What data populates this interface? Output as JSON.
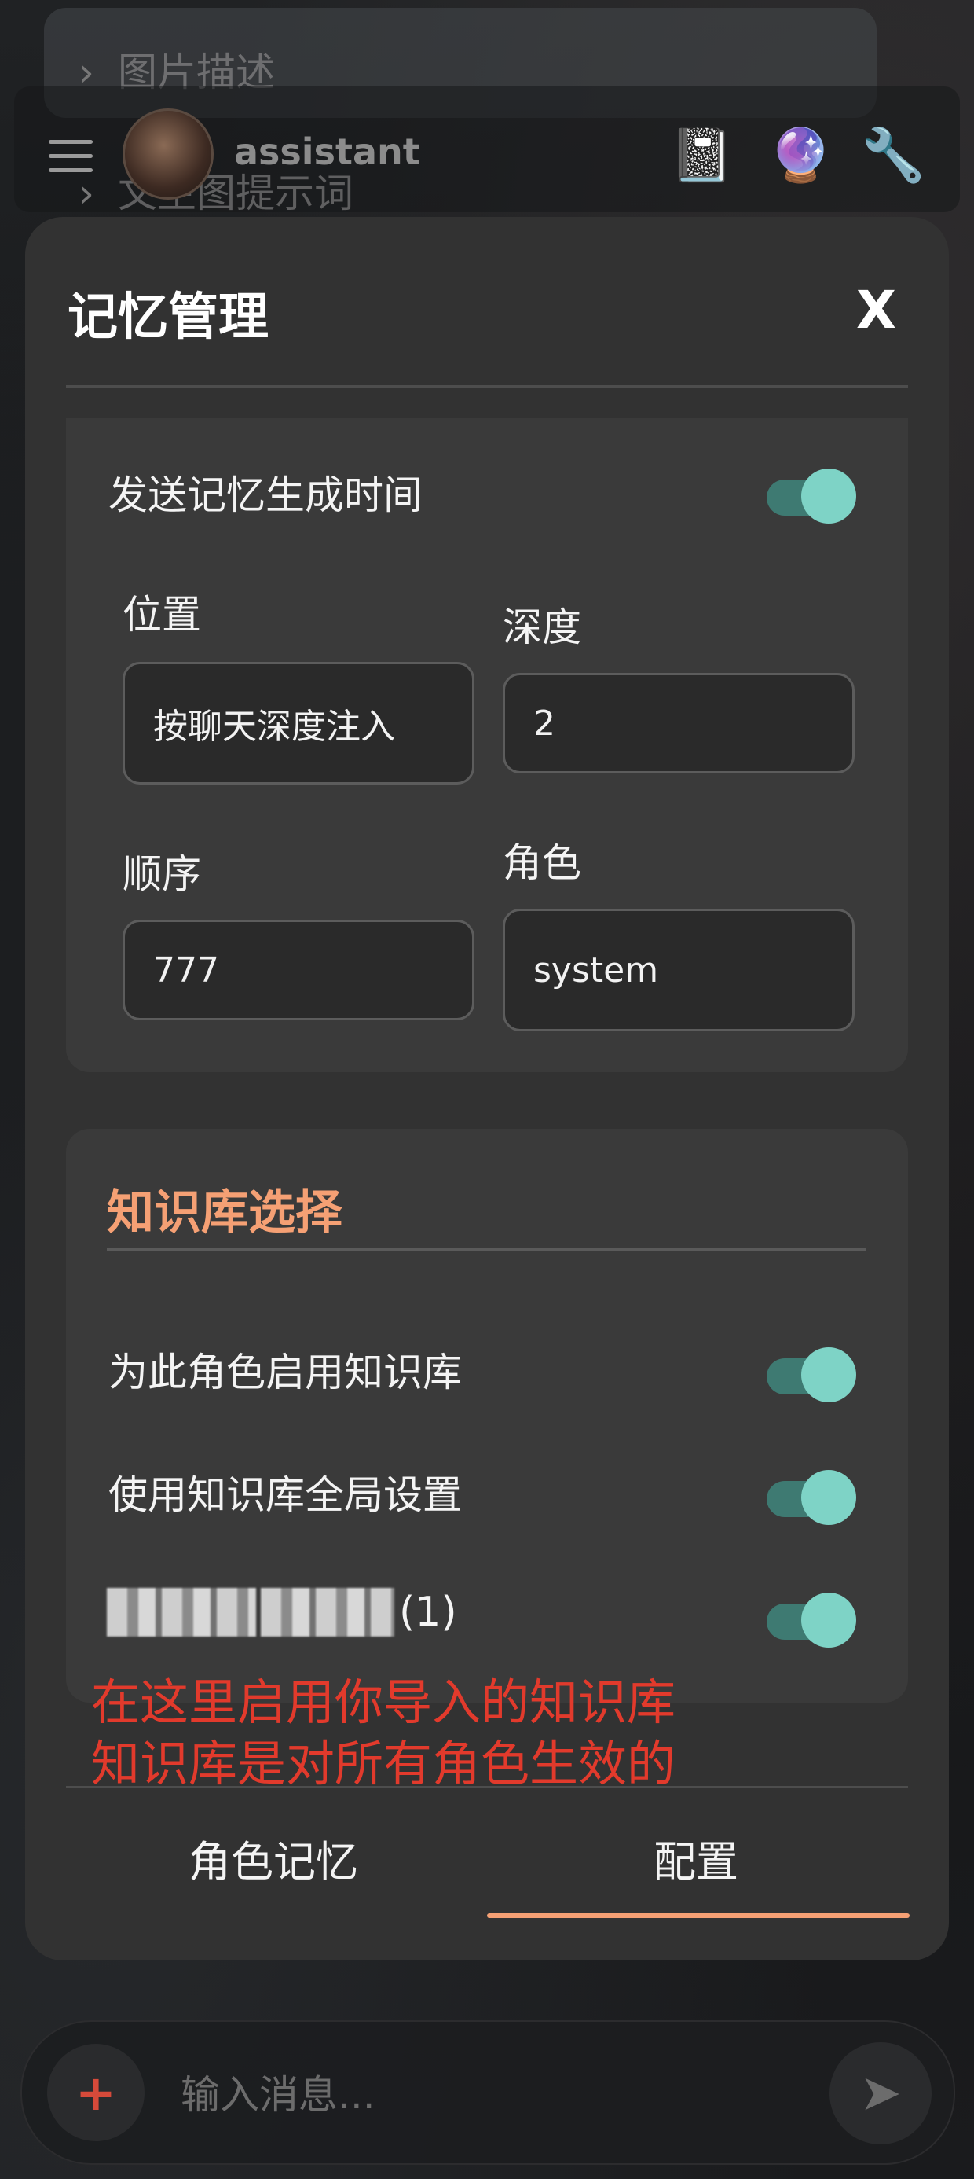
{
  "header": {
    "ghost_row_1": "图片描述",
    "ghost_row_2": "文生图提示词",
    "assistant_name": "assistant",
    "icons": [
      "notebook-icon",
      "crystal-ball-icon",
      "wrench-icon"
    ]
  },
  "modal": {
    "title": "记忆管理",
    "close_label": "X",
    "memory_time": {
      "label": "发送记忆生成时间",
      "enabled": true
    },
    "fields": {
      "position_label": "位置",
      "position_value": "按聊天深度注入",
      "depth_label": "深度",
      "depth_value": "2",
      "order_label": "顺序",
      "order_value": "777",
      "role_label": "角色",
      "role_value": "system"
    },
    "knowledge": {
      "title": "知识库选择",
      "enable_for_role_label": "为此角色启用知识库",
      "enable_for_role": true,
      "use_global_label": "使用知识库全局设置",
      "use_global": true,
      "kb_item_suffix": "(1)",
      "kb_item_enabled": true
    },
    "annotation_line_1": "在这里启用你导入的知识库",
    "annotation_line_2": "知识库是对所有角色生效的",
    "tabs": [
      {
        "label": "角色记忆",
        "active": false
      },
      {
        "label": "配置",
        "active": true
      }
    ]
  },
  "composer": {
    "plus_label": "+",
    "placeholder": "输入消息..."
  },
  "colors": {
    "accent": "#f5a074",
    "toggle_on": "#7ed3c6",
    "annotation": "#e23a2c"
  }
}
